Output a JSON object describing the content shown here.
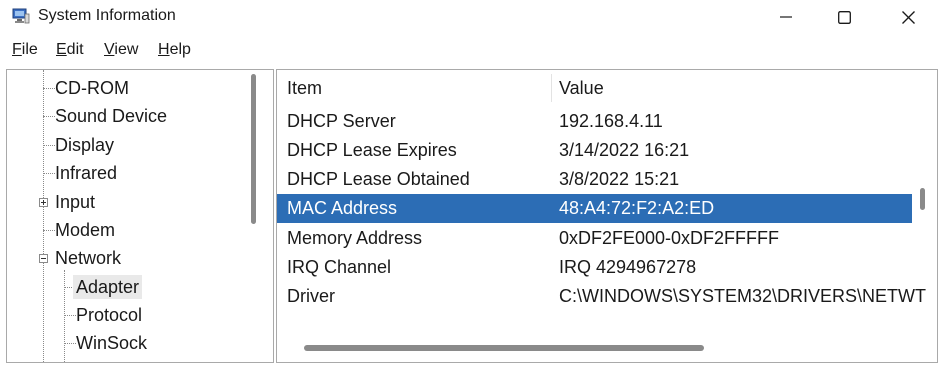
{
  "window": {
    "title": "System Information"
  },
  "menu": [
    {
      "label": "File",
      "accel": "F",
      "rest": "ile"
    },
    {
      "label": "Edit",
      "accel": "E",
      "rest": "dit"
    },
    {
      "label": "View",
      "accel": "V",
      "rest": "iew"
    },
    {
      "label": "Help",
      "accel": "H",
      "rest": "elp"
    }
  ],
  "tree": {
    "items": [
      {
        "label": "CD-ROM"
      },
      {
        "label": "Sound Device"
      },
      {
        "label": "Display"
      },
      {
        "label": "Infrared"
      },
      {
        "label": "Input"
      },
      {
        "label": "Modem"
      },
      {
        "label": "Network"
      },
      {
        "label": "Adapter"
      },
      {
        "label": "Protocol"
      },
      {
        "label": "WinSock"
      }
    ]
  },
  "list": {
    "columns": [
      "Item",
      "Value"
    ],
    "rows": [
      {
        "item": "DHCP Server",
        "value": "192.168.4.11"
      },
      {
        "item": "DHCP Lease Expires",
        "value": "3/14/2022 16:21"
      },
      {
        "item": "DHCP Lease Obtained",
        "value": "3/8/2022 15:21"
      },
      {
        "item": "MAC Address",
        "value": "48:A4:72:F2:A2:ED"
      },
      {
        "item": "Memory Address",
        "value": "0xDF2FE000-0xDF2FFFFF"
      },
      {
        "item": "IRQ Channel",
        "value": "IRQ 4294967278"
      },
      {
        "item": "Driver",
        "value": "C:\\WINDOWS\\SYSTEM32\\DRIVERS\\NETWT"
      }
    ],
    "selected_item": "MAC Address"
  },
  "colors": {
    "selection": "#2c6db5",
    "tree_selection": "#e9e9e9"
  }
}
